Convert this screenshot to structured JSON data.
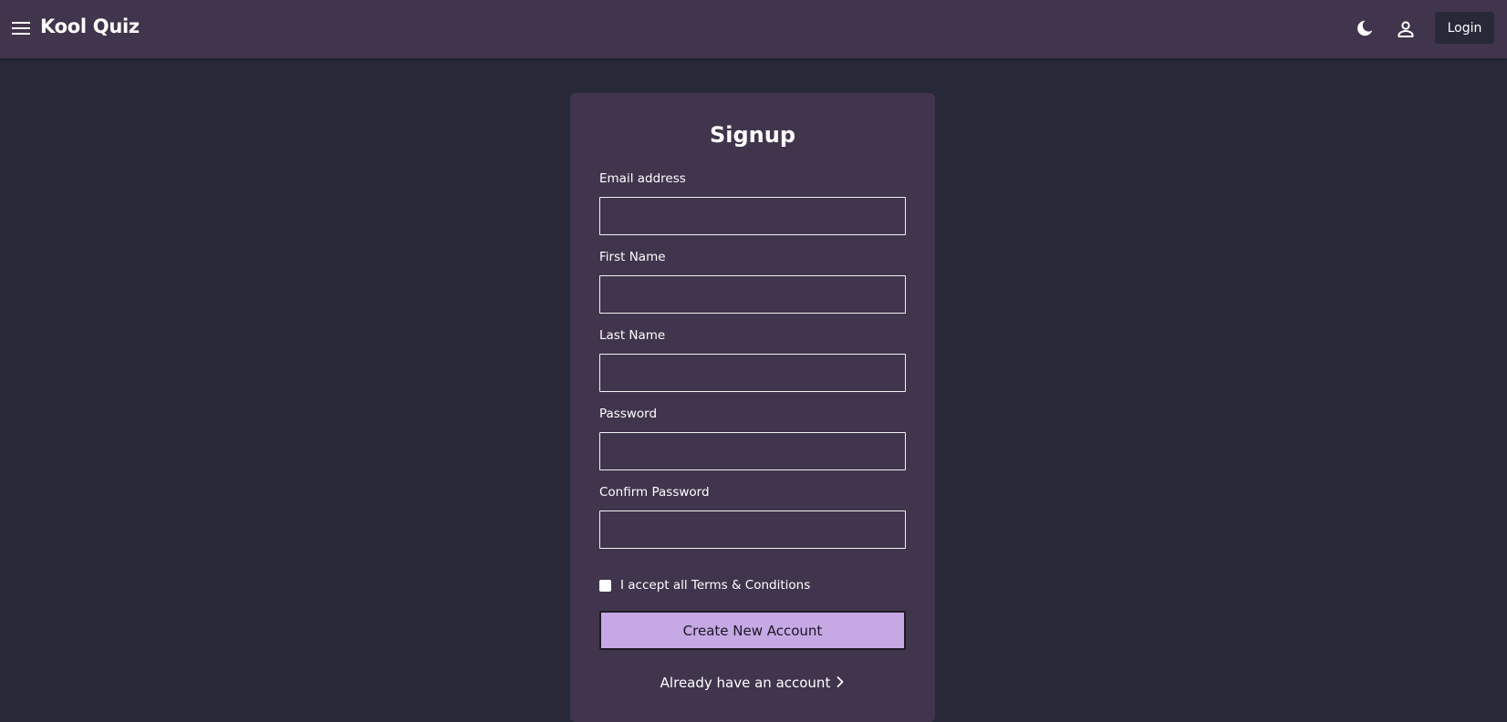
{
  "header": {
    "brand": "Kool Quiz",
    "login_label": "Login",
    "menu_icon": "hamburger-menu-icon",
    "theme_icon": "moon-icon",
    "user_icon": "person-icon"
  },
  "form": {
    "title": "Signup",
    "fields": [
      {
        "label": "Email address",
        "value": "",
        "type": "email"
      },
      {
        "label": "First Name",
        "value": "",
        "type": "text"
      },
      {
        "label": "Last Name",
        "value": "",
        "type": "text"
      },
      {
        "label": "Password",
        "value": "",
        "type": "password"
      },
      {
        "label": "Confirm Password",
        "value": "",
        "type": "password"
      }
    ],
    "terms_label": "I accept all Terms & Conditions",
    "terms_checked": false,
    "submit_label": "Create New Account",
    "login_link": "Already have an account"
  },
  "colors": {
    "background": "#272838",
    "surface": "#40354d",
    "accent": "#c5a8e4",
    "text": "#ffffff"
  }
}
